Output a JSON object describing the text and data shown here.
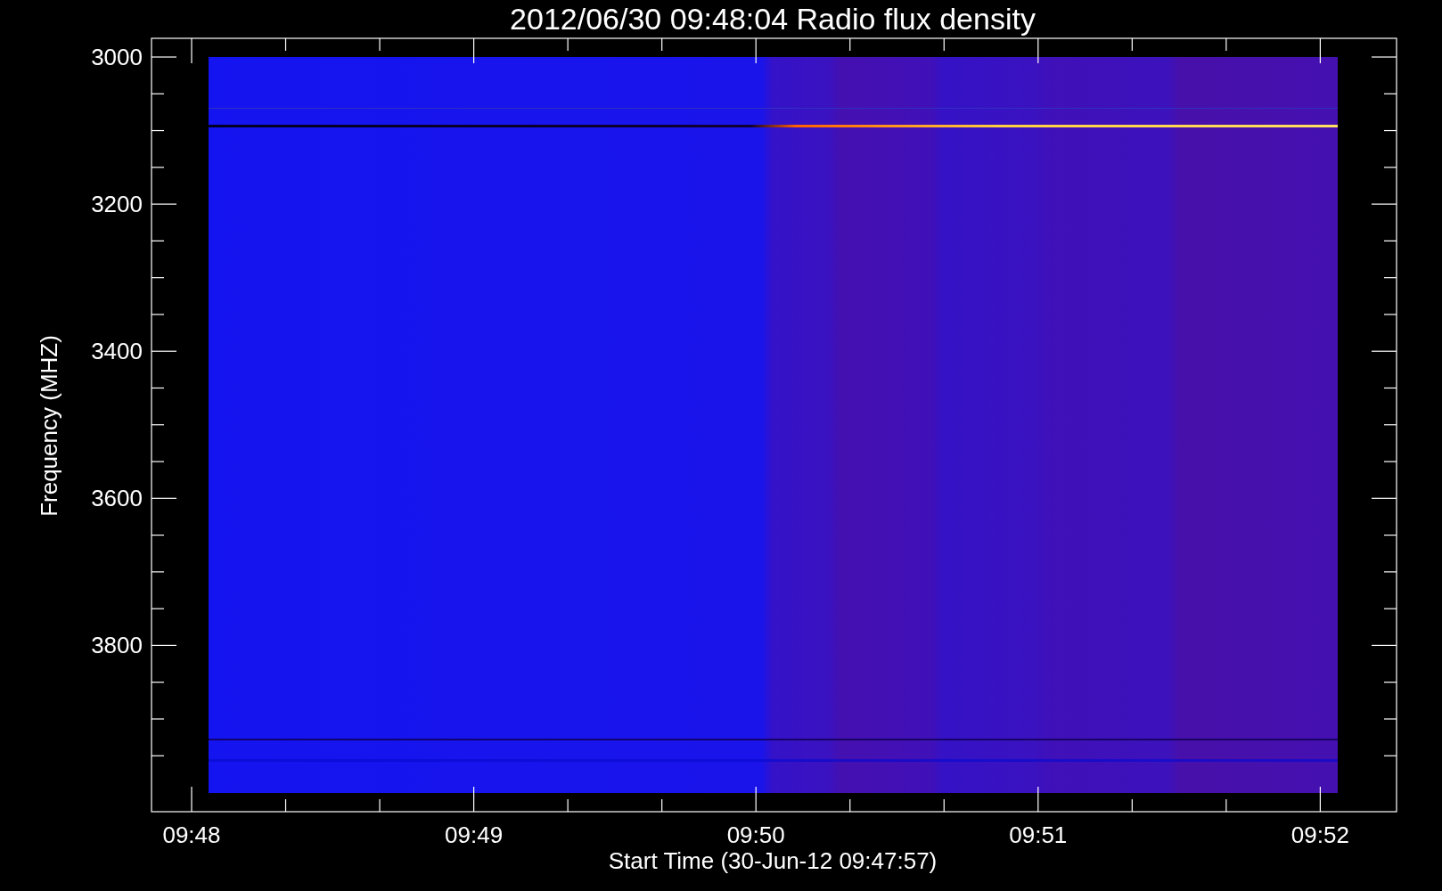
{
  "plot": {
    "title": "2012/06/30 09:48:04 Radio flux density",
    "x_axis": {
      "label": "Start Time (30-Jun-12 09:47:57)",
      "ticks": [
        "09:48",
        "09:49",
        "09:50",
        "09:51",
        "09:52"
      ]
    },
    "y_axis": {
      "label": "Frequency (MHZ)",
      "ticks": [
        "3000",
        "3200",
        "3400",
        "3600",
        "3800"
      ]
    }
  }
}
